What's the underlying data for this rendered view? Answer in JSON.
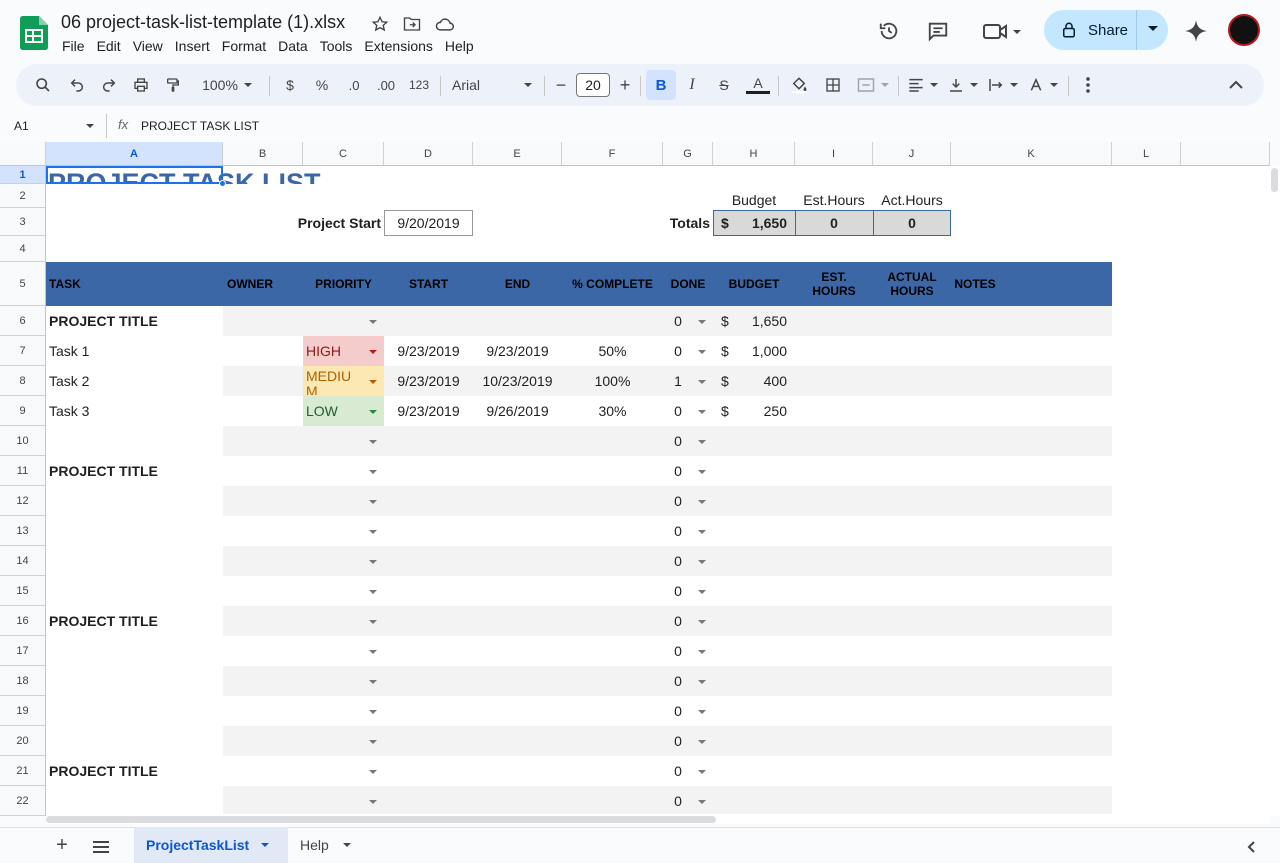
{
  "app": {
    "doc_title": "06 project-task-list-template (1).xlsx",
    "share_label": "Share"
  },
  "menu": [
    "File",
    "Edit",
    "View",
    "Insert",
    "Format",
    "Data",
    "Tools",
    "Extensions",
    "Help"
  ],
  "toolbar": {
    "zoom": "100%",
    "currency": "$",
    "percent": "%",
    "dec_decrease": ".0",
    "dec_increase": ".00",
    "format_123": "123",
    "font": "Arial",
    "font_size": "20",
    "bold": "B",
    "italic": "I",
    "strike": "S",
    "text_color": "A"
  },
  "formula_bar": {
    "name_box": "A1",
    "fx": "fx",
    "content": "PROJECT TASK LIST"
  },
  "columns": [
    "A",
    "B",
    "C",
    "D",
    "E",
    "F",
    "G",
    "H",
    "I",
    "J",
    "K",
    "L"
  ],
  "rows": [
    "1",
    "2",
    "3",
    "4",
    "5",
    "6",
    "7",
    "8",
    "9",
    "10",
    "11",
    "12",
    "13",
    "14",
    "15",
    "16",
    "17",
    "18",
    "19",
    "20",
    "21",
    "22"
  ],
  "sheet": {
    "title": "PROJECT TASK LIST",
    "budget_label": "Budget",
    "est_hours_label": "Est.Hours",
    "act_hours_label": "Act.Hours",
    "project_start_label": "Project Start",
    "project_start_value": "9/20/2019",
    "totals_label": "Totals",
    "totals_currency": "$",
    "totals_budget": "1,650",
    "totals_est": "0",
    "totals_act": "0",
    "headers": {
      "task": "TASK",
      "owner": "OWNER",
      "priority": "PRIORITY",
      "start": "START",
      "end": "END",
      "complete": "% COMPLETE",
      "done": "DONE",
      "budget": "BUDGET",
      "est": "EST. HOURS",
      "actual": "ACTUAL HOURS",
      "notes": "NOTES"
    },
    "project_title_label": "PROJECT TITLE",
    "row6": {
      "done": "0",
      "currency": "$",
      "budget": "1,650"
    },
    "tasks": [
      {
        "name": "Task 1",
        "priority": "HIGH",
        "start": "9/23/2019",
        "end": "9/23/2019",
        "complete": "50%",
        "done": "0",
        "currency": "$",
        "budget": "1,000"
      },
      {
        "name": "Task 2",
        "priority": "MEDIU M",
        "start": "9/23/2019",
        "end": "10/23/2019",
        "complete": "100%",
        "done": "1",
        "currency": "$",
        "budget": "400"
      },
      {
        "name": "Task 3",
        "priority": "LOW",
        "start": "9/23/2019",
        "end": "9/26/2019",
        "complete": "30%",
        "done": "0",
        "currency": "$",
        "budget": "250"
      }
    ],
    "zero": "0",
    "colors": {
      "header_bg": "#3c67a7",
      "high": "#f4cccc",
      "medium": "#fce8b2",
      "low": "#d9ead3",
      "band": "#f3f3f3",
      "title": "#3c67a7"
    }
  },
  "tabs": {
    "active": "ProjectTaskList",
    "other": "Help"
  }
}
